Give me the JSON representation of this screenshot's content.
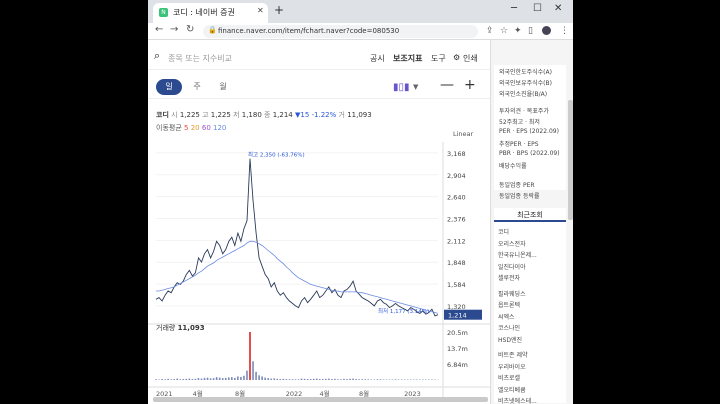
{
  "browser": {
    "tab_title": "코디 : 네이버 증권",
    "favicon": "N",
    "url": "finance.naver.com/item/fchart.naver?code=080530"
  },
  "toolbar": {
    "search_placeholder": "종목 또는 지수비교",
    "links": [
      "공시",
      "보조지표",
      "도구",
      "인쇄"
    ]
  },
  "periods": [
    "일",
    "주",
    "월"
  ],
  "quote": {
    "name": "코디",
    "open_label": "시",
    "open": "1,225",
    "high_label": "고",
    "high": "1,225",
    "low_label": "저",
    "low": "1,180",
    "close_label": "종",
    "close": "1,214",
    "change": "▼15 -1.22%",
    "vol_label": "거",
    "vol": "11,093"
  },
  "moving_avg": {
    "label": "이동평균",
    "periods": [
      "5",
      "20",
      "60",
      "120"
    ],
    "colors": [
      "#e8483a",
      "#e89a2a",
      "#9a56c8",
      "#6a8ae0"
    ]
  },
  "scale_label": "Linear",
  "chart_data": {
    "type": "line",
    "price_axis_ticks": [
      "3,168",
      "2,904",
      "2,640",
      "2,376",
      "2,112",
      "1,848",
      "1,584",
      "1,320"
    ],
    "current_price": "1,214",
    "max_label": "최고 2,350 (-63.76%)",
    "min_label": "최저 1,177 (3.14%)",
    "volume_label": "거래량",
    "volume": "11,093",
    "volume_axis_ticks": [
      "20.5m",
      "13.7m",
      "6.84m"
    ],
    "x_ticks": [
      "2021",
      "4월",
      "8월",
      "2022",
      "4월",
      "8월",
      "2023"
    ],
    "ylim": [
      1150,
      3300
    ],
    "series": [
      {
        "name": "price",
        "color": "#2a3a5a",
        "values": [
          1400,
          1420,
          1380,
          1450,
          1500,
          1480,
          1550,
          1600,
          1580,
          1620,
          1700,
          1750,
          1680,
          1720,
          1900,
          1850,
          1950,
          2000,
          1900,
          1980,
          2100,
          2050,
          1950,
          2000,
          2100,
          2150,
          2050,
          2200,
          2100,
          2250,
          2350,
          3100,
          2600,
          2200,
          1900,
          1800,
          1700,
          1650,
          1550,
          1600,
          1500,
          1450,
          1480,
          1420,
          1380,
          1350,
          1320,
          1300,
          1380,
          1420,
          1360,
          1400,
          1450,
          1500,
          1420,
          1450,
          1500,
          1550,
          1480,
          1520,
          1450,
          1420,
          1500,
          1520,
          1560,
          1620,
          1500,
          1460,
          1420,
          1400,
          1380,
          1350,
          1320,
          1380,
          1400,
          1360,
          1340,
          1300,
          1320,
          1350,
          1320,
          1300,
          1280,
          1260,
          1300,
          1280,
          1250,
          1230,
          1260,
          1220,
          1240,
          1280,
          1200,
          1214
        ]
      },
      {
        "name": "MA120",
        "color": "#6a8ae0",
        "values": [
          1500,
          1500,
          1510,
          1520,
          1530,
          1540,
          1550,
          1570,
          1590,
          1610,
          1630,
          1650,
          1670,
          1690,
          1720,
          1740,
          1770,
          1800,
          1820,
          1840,
          1870,
          1890,
          1910,
          1930,
          1950,
          1970,
          1990,
          2010,
          2030,
          2050,
          2080,
          2100,
          2100,
          2090,
          2070,
          2050,
          2020,
          1990,
          1960,
          1930,
          1890,
          1860,
          1830,
          1790,
          1760,
          1720,
          1690,
          1660,
          1640,
          1620,
          1600,
          1580,
          1570,
          1560,
          1550,
          1540,
          1530,
          1520,
          1510,
          1500,
          1500,
          1490,
          1490,
          1490,
          1490,
          1490,
          1490,
          1480,
          1480,
          1470,
          1460,
          1450,
          1440,
          1430,
          1420,
          1410,
          1400,
          1390,
          1380,
          1370,
          1360,
          1350,
          1340,
          1330,
          1320,
          1310,
          1300,
          1290,
          1280,
          1270,
          1260,
          1250,
          1240,
          1230
        ]
      }
    ],
    "volume_values": [
      0.3,
      0.2,
      0.4,
      0.3,
      0.5,
      0.3,
      0.4,
      0.6,
      0.3,
      0.4,
      0.5,
      0.6,
      0.4,
      0.5,
      0.8,
      0.6,
      0.9,
      1.0,
      0.7,
      0.8,
      1.2,
      1.0,
      0.8,
      0.9,
      1.1,
      1.2,
      0.9,
      1.5,
      1.3,
      1.8,
      4.0,
      20.5,
      8.0,
      3.5,
      2.0,
      1.5,
      1.0,
      0.8,
      0.6,
      0.7,
      0.5,
      0.4,
      0.5,
      0.4,
      0.3,
      0.3,
      0.3,
      0.3,
      0.6,
      0.5,
      0.4,
      0.4,
      0.5,
      0.6,
      0.4,
      0.4,
      0.5,
      0.6,
      0.4,
      0.5,
      0.3,
      0.3,
      0.5,
      0.4,
      0.5,
      0.6,
      0.4,
      0.3,
      0.3,
      0.3,
      0.3,
      0.2,
      0.2,
      0.3,
      0.3,
      0.2,
      0.2,
      0.2,
      0.2,
      0.3,
      0.2,
      0.2,
      0.2,
      0.2,
      0.2,
      0.2,
      0.2,
      0.2,
      0.2,
      0.2,
      0.2,
      0.2,
      0.2,
      0.1
    ]
  },
  "sidebar": {
    "info_items": [
      "외국인한도주식수(A)",
      "외국인보유주식수(B)",
      "외국인소진율(B/A)",
      "투자의견 · 목표주가",
      "52주최고 · 최저",
      "PER · EPS (2022.09)",
      "추정PER · EPS",
      "PBR · BPS (2022.09)",
      "배당수익률",
      "동일업종 PER",
      "동일업종 등락률"
    ],
    "recent_title": "최근조회",
    "recent_items": [
      "코디",
      "오리스전자",
      "한국유니온제...",
      "일진다이아",
      "셀루전자",
      "필라웨딩스",
      "옵트론텍",
      "씨엑스",
      "코스나인",
      "HSD엔진",
      "비트존 제약",
      "우리바이오",
      "비츠로셀",
      "엘오티베큠",
      "비츠넷에스테..."
    ]
  }
}
